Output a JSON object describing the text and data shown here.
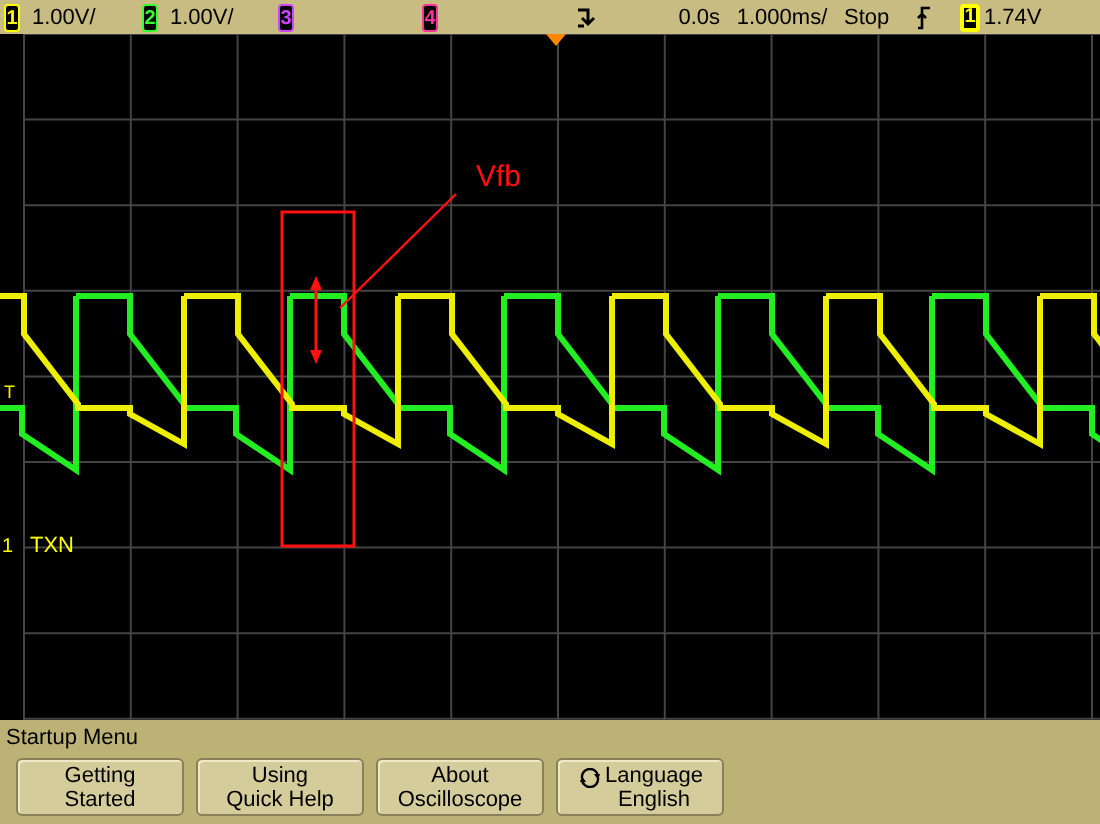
{
  "status_bar": {
    "channels": [
      {
        "number": "1",
        "scale": "1.00V/",
        "color": "#ffff00"
      },
      {
        "number": "2",
        "scale": "1.00V/",
        "color": "#33ff33"
      },
      {
        "number": "3",
        "color": "#cc44ff"
      },
      {
        "number": "4",
        "color": "#ff3399"
      }
    ],
    "delay": "0.0s",
    "timebase": "1.000ms/",
    "run_state": "Stop",
    "trigger_source": {
      "number": "1",
      "color": "#ffff00"
    },
    "trigger_level": "1.74V"
  },
  "waveform": {
    "annotation": "Vfb",
    "trigger_marker": "T",
    "channel_label": {
      "number": "1",
      "name": "TXN",
      "color": "#ffff00"
    }
  },
  "menu": {
    "title": "Startup Menu",
    "softkeys": [
      {
        "kind": "plain",
        "lines": [
          "Getting",
          "Started"
        ]
      },
      {
        "kind": "plain",
        "lines": [
          "Using",
          "Quick Help"
        ]
      },
      {
        "kind": "plain",
        "lines": [
          "About",
          "Oscilloscope"
        ]
      },
      {
        "kind": "cycle",
        "lines": [
          "Language",
          "English"
        ]
      }
    ]
  }
}
